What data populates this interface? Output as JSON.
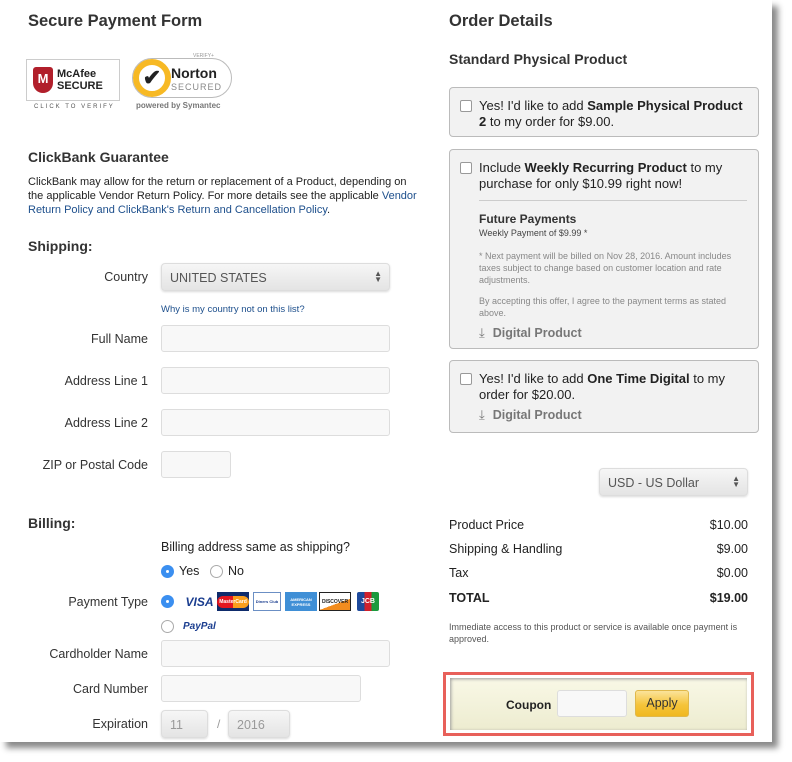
{
  "left": {
    "title": "Secure Payment Form",
    "badges": {
      "mcafee": "McAfee SECURE",
      "mcafee_sub": "CLICK TO VERIFY",
      "norton_top": "VERIFY+",
      "norton": "Norton",
      "norton_secured": "SECURED",
      "norton_powered": "powered by Symantec"
    },
    "guarantee": {
      "title": "ClickBank Guarantee",
      "text": "ClickBank may allow for the return or replacement of a Product, depending on the applicable Vendor Return Policy. For more details see the applicable",
      "link": "Vendor Return Policy and ClickBank's Return and Cancellation Policy",
      "end": "."
    },
    "shipping": {
      "title": "Shipping:",
      "country_label": "Country",
      "country_value": "UNITED STATES",
      "country_link": "Why is my country not on this list?",
      "full_name": "Full Name",
      "address1": "Address Line 1",
      "address2": "Address Line 2",
      "zip": "ZIP or Postal Code"
    },
    "billing": {
      "title": "Billing:",
      "same_question": "Billing address same as shipping?",
      "yes": "Yes",
      "no": "No",
      "payment_type": "Payment Type",
      "cards": [
        "VISA",
        "MasterCard",
        "Diners Club",
        "AMERICAN EXPRESS",
        "DISCOVER",
        "JCB"
      ],
      "paypal": "PayPal",
      "cardholder": "Cardholder Name",
      "card_number": "Card Number",
      "expiration": "Expiration",
      "exp_month": "11",
      "exp_sep": "/",
      "exp_year": "2016"
    }
  },
  "right": {
    "title": "Order Details",
    "product": "Standard Physical Product",
    "offer1": {
      "pre": "Yes! I'd like to add ",
      "bold": "Sample Physical Product 2",
      "post": " to my order for $9.00."
    },
    "offer2": {
      "pre": "Include ",
      "bold": "Weekly Recurring Product",
      "post": " to my purchase for only $10.99 right now!",
      "future_title": "Future Payments",
      "future_sub": "Weekly Payment of $9.99 *",
      "note1": "* Next payment will be billed on Nov 28, 2016. Amount includes taxes subject to change based on customer location and rate adjustments.",
      "note2": "By accepting this offer, I agree to the payment terms as stated above.",
      "type": "Digital Product"
    },
    "offer3": {
      "pre": "Yes! I'd like to add ",
      "bold": "One Time Digital",
      "post": " to my order for $20.00.",
      "type": "Digital Product"
    },
    "currency": "USD - US Dollar",
    "summary": [
      {
        "label": "Product Price",
        "value": "$10.00"
      },
      {
        "label": "Shipping & Handling",
        "value": "$9.00"
      },
      {
        "label": "Tax",
        "value": "$0.00"
      },
      {
        "label": "TOTAL",
        "value": "$19.00"
      }
    ],
    "access_note": "Immediate access to this product or service is available once payment is approved.",
    "coupon": {
      "label": "Coupon",
      "value": "",
      "apply": "Apply"
    }
  },
  "colors": {
    "link": "#1d4f8c",
    "radio": "#3b8ff0",
    "highlight": "#e8605a",
    "apply": "#f5c43a"
  }
}
